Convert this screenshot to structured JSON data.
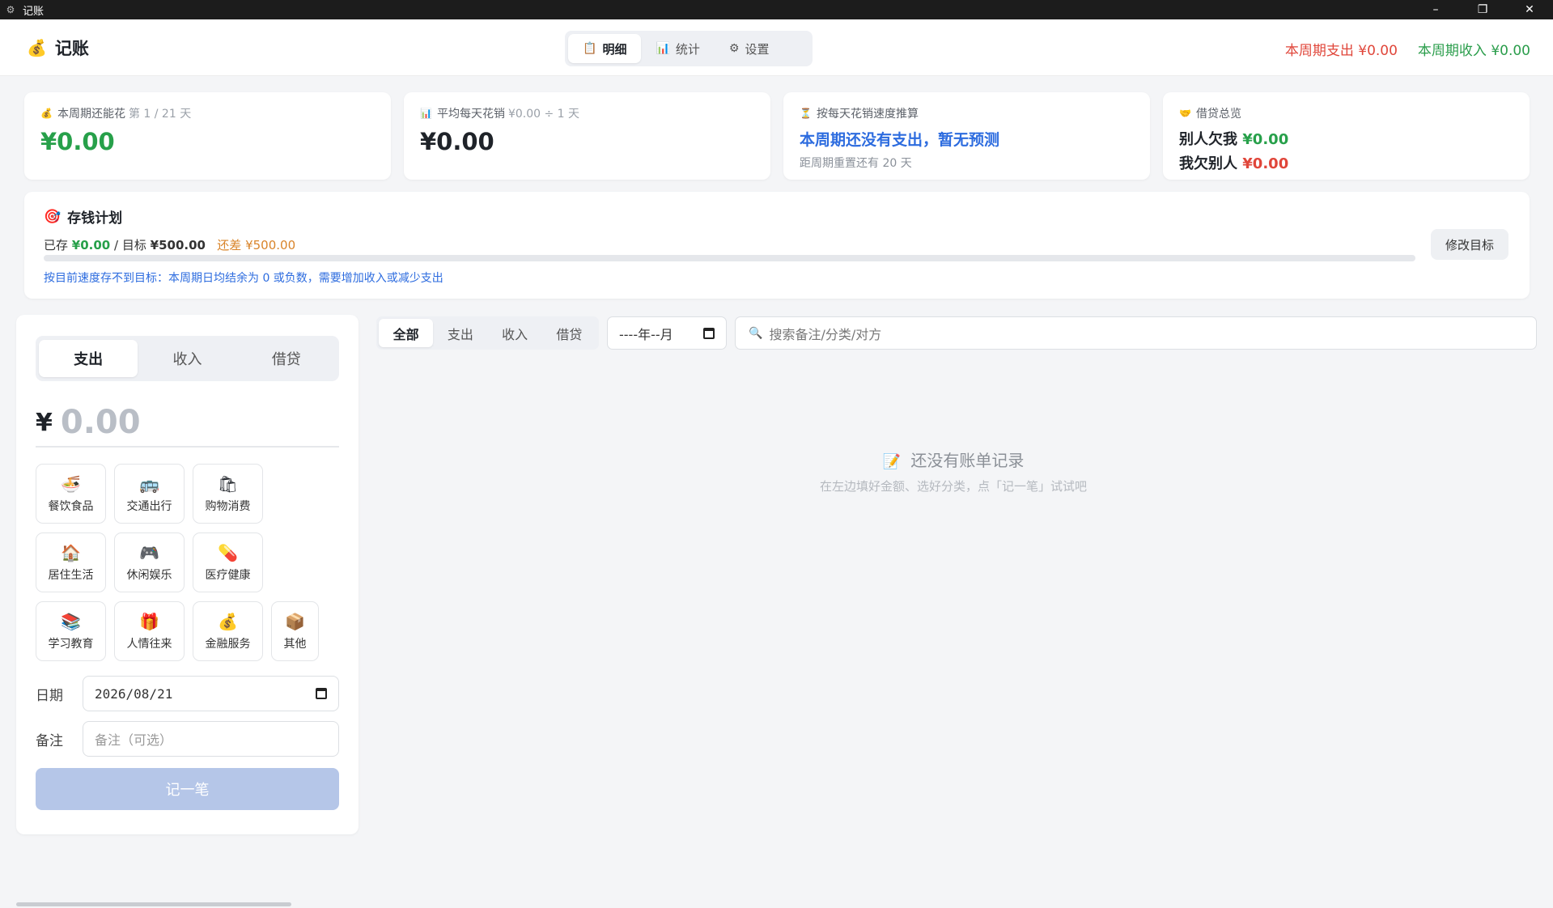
{
  "window": {
    "title": "记账",
    "minimize": "–",
    "restore": "❐",
    "close": "✕"
  },
  "header": {
    "brand": "记账",
    "tabs": [
      {
        "label": "明细",
        "icon": "clipboard-icon"
      },
      {
        "label": "统计",
        "icon": "bar-chart-icon"
      },
      {
        "label": "设置",
        "icon": "gear-icon"
      }
    ],
    "active_tab": "明细",
    "period_expense": "本周期支出 ¥0.00",
    "period_income": "本周期收入 ¥0.00"
  },
  "summary": {
    "remaining": {
      "label": "本周期还能花",
      "sub": "第 1 / 21 天",
      "value": "¥0.00"
    },
    "daily_avg": {
      "label": "平均每天花销",
      "sub": "¥0.00 ÷ 1 天",
      "value": "¥0.00"
    },
    "forecast": {
      "label": "按每天花销速度推算",
      "headline": "本周期还没有支出，暂无预测",
      "note": "距周期重置还有 20 天"
    },
    "debt": {
      "label": "借贷总览",
      "owed_to_me_label": "别人欠我",
      "owed_to_me": "¥0.00",
      "i_owe_label": "我欠别人",
      "i_owe": "¥0.00"
    }
  },
  "savings_plan": {
    "title": "存钱计划",
    "saved_label": "已存",
    "saved": "¥0.00",
    "target_label": "/ 目标",
    "target": "¥500.00",
    "remaining_label": "还差",
    "remaining": "¥500.00",
    "progress": 0,
    "hint": "按目前速度存不到目标：本周期日均结余为 0 或负数，需要增加收入或减少支出",
    "edit_button": "修改目标"
  },
  "entry": {
    "types": [
      "支出",
      "收入",
      "借贷"
    ],
    "active_type": "支出",
    "currency": "¥",
    "amount_placeholder": "0.00",
    "categories": [
      {
        "label": "餐饮食品",
        "icon": "noodle-bowl-icon",
        "glyph": "🍜"
      },
      {
        "label": "交通出行",
        "icon": "bus-icon",
        "glyph": "🚌"
      },
      {
        "label": "购物消费",
        "icon": "shopping-bag-icon",
        "glyph": "🛍"
      },
      {
        "label": "居住生活",
        "icon": "house-icon",
        "glyph": "🏠"
      },
      {
        "label": "休闲娱乐",
        "icon": "gamepad-icon",
        "glyph": "🎮"
      },
      {
        "label": "医疗健康",
        "icon": "pill-icon",
        "glyph": "💊"
      },
      {
        "label": "学习教育",
        "icon": "books-icon",
        "glyph": "📚"
      },
      {
        "label": "人情往来",
        "icon": "gift-icon",
        "glyph": "🎁"
      },
      {
        "label": "金融服务",
        "icon": "money-bag-icon",
        "glyph": "💰"
      },
      {
        "label": "其他",
        "icon": "package-icon",
        "glyph": "📦"
      }
    ],
    "date_label": "日期",
    "date_value": "2026/08/21",
    "note_label": "备注",
    "note_placeholder": "备注（可选）",
    "submit": "记一笔"
  },
  "list": {
    "filters": [
      "全部",
      "支出",
      "收入",
      "借贷"
    ],
    "active_filter": "全部",
    "month_placeholder": "----年--月",
    "search_placeholder": "搜索备注/分类/对方",
    "empty_title": "还没有账单记录",
    "empty_sub": "在左边填好金额、选好分类，点「记一笔」试试吧"
  },
  "colors": {
    "expense": "#e0463a",
    "income": "#27a04a",
    "accent": "#2d6cdf",
    "warning": "#d9842a"
  }
}
